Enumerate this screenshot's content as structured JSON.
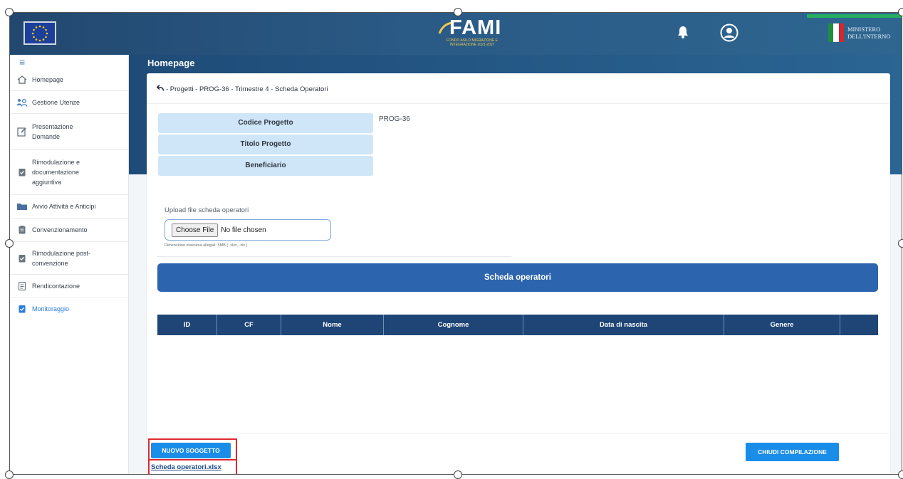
{
  "header": {
    "logo_text": "FAMI",
    "logo_subtitle": "FONDO ASILO MIGRAZIONE E INTEGRAZIONE 2021-2027",
    "ministero_line1": "MINISTERO",
    "ministero_line2": "DELL'INTERNO"
  },
  "sidebar": {
    "menu_icon": "hamburger-icon",
    "items": [
      {
        "label": "Homepage",
        "icon": "home-icon"
      },
      {
        "label": "Gestione Utenze",
        "icon": "users-icon"
      },
      {
        "label": "Presentazione Domande",
        "icon": "edit-icon"
      },
      {
        "label": "Rimodulazione e documentazione aggiuntiva",
        "icon": "clipboard-check-icon"
      },
      {
        "label": "Avvio Attività e Anticipi",
        "icon": "folder-icon"
      },
      {
        "label": "Convenzionamento",
        "icon": "clipboard-icon"
      },
      {
        "label": "Rimodulazione post-convenzione",
        "icon": "clipboard-check-icon"
      },
      {
        "label": "Rendicontazione",
        "icon": "document-icon"
      },
      {
        "label": "Monitoraggio",
        "icon": "clipboard-check-icon"
      }
    ]
  },
  "page": {
    "title": "Homepage",
    "breadcrumb": "- Progetti - PROG-36 - Trimestre 4 - Scheda Operatori"
  },
  "info": {
    "codice_label": "Codice Progetto",
    "codice_value": "PROG-36",
    "titolo_label": "Titolo Progetto",
    "titolo_value": "",
    "beneficiario_label": "Beneficiario",
    "beneficiario_value": ""
  },
  "upload": {
    "label": "Upload file scheda operatori",
    "button": "Choose File",
    "status": "No file chosen",
    "hint": "Dimensione massima allegati: 5MB ( .xlsx, .xls )"
  },
  "section": {
    "title": "Scheda operatori"
  },
  "table": {
    "columns": [
      "ID",
      "CF",
      "Nome",
      "Cognome",
      "Data di nascita",
      "Genere",
      ""
    ],
    "rows": []
  },
  "actions": {
    "nuovo": "NUOVO SOGGETTO",
    "xlsx": "Scheda operatori.xlsx",
    "chiudi": "CHIUDI COMPILAZIONE"
  },
  "colors": {
    "header": "#22486f",
    "accent": "#1a8de8",
    "section": "#2d64ae",
    "table_header": "#1e4576",
    "info_label_bg": "#cfe5f8",
    "highlight": "#e0282f"
  }
}
